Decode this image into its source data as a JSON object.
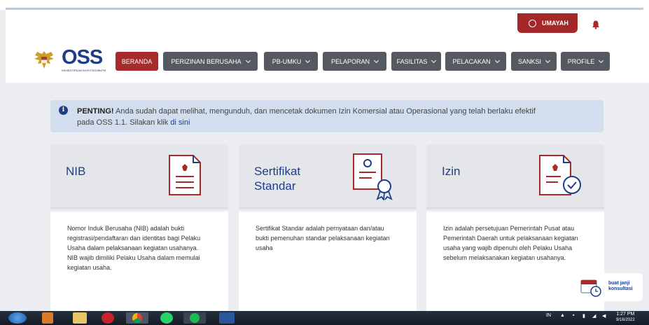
{
  "header": {
    "user_label": "UMAYAH"
  },
  "logo": {
    "word": "OSS",
    "tagline": "KEMENTERIAN INVESTASI/BKPM"
  },
  "nav": {
    "beranda": "BERANDA",
    "perizinan": "PERIZINAN BERUSAHA",
    "pbumku": "PB-UMKU",
    "pelaporan": "PELAPORAN",
    "fasilitas": "FASILITAS",
    "pelacakan": "PELACAKAN",
    "sanksi": "SANKSI",
    "profile": "PROFILE"
  },
  "notice": {
    "strong": "PENTING!",
    "line1": " Anda sudah dapat melihat, mengunduh, dan mencetak dokumen Izin Komersial atau Operasional yang telah berlaku efektif",
    "line2": "pada OSS 1.1. Silakan klik ",
    "link": "di sini"
  },
  "cards": [
    {
      "title": "NIB",
      "desc": "Nomor Induk Berusaha (NIB) adalah bukti registrasi/pendaftaran dan identitas bagi Pelaku Usaha dalam pelaksanaan kegiatan usahanya. NIB wajib dimiliki Pelaku Usaha dalam memulai kegiatan usaha."
    },
    {
      "title": "Sertifikat Standar",
      "desc": "Sertifikat Standar adalah pernyataan dan/atau bukti pemenuhan standar pelaksanaan kegiatan usaha"
    },
    {
      "title": "Izin",
      "desc": "Izin adalah persetujuan Pemerintah Pusat atau Pemerintah Daerah untuk pelaksanaan kegiatan usaha yang wajib dipenuhi oleh Pelaku Usaha sebelum melaksanakan kegiatan usahanya."
    }
  ],
  "janji": {
    "line1": "buat janji",
    "line2": "konsultasi"
  },
  "taskbar": {
    "lang": "IN",
    "time": "1:27 PM",
    "date": "9/16/2022"
  },
  "colors": {
    "brand_red": "#a82b2b",
    "brand_blue": "#1e3e8a",
    "nav_gray": "#555a61"
  }
}
